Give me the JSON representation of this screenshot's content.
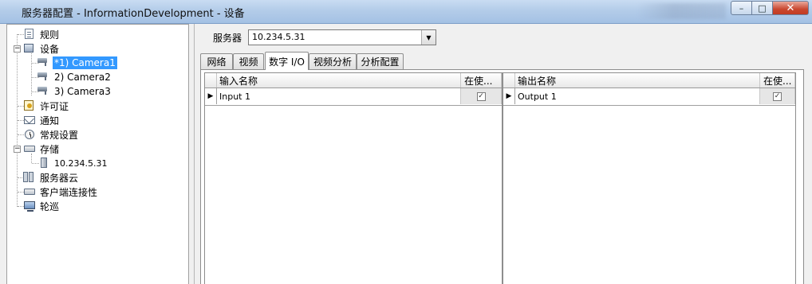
{
  "window": {
    "title": "服务器配置 - InformationDevelopment - 设备"
  },
  "tree": {
    "items": [
      {
        "label": "规则",
        "icon": "rules-doc-icon"
      },
      {
        "label": "设备",
        "icon": "device-icon",
        "expanded": true
      },
      {
        "label": "*1) Camera1",
        "icon": "camera-icon",
        "selected": true
      },
      {
        "label": "2) Camera2",
        "icon": "camera-icon"
      },
      {
        "label": "3) Camera3",
        "icon": "camera-icon"
      },
      {
        "label": "许可证",
        "icon": "license-icon"
      },
      {
        "label": "通知",
        "icon": "mail-icon"
      },
      {
        "label": "常规设置",
        "icon": "clock-icon"
      },
      {
        "label": "存储",
        "icon": "drive-icon",
        "expanded": true
      },
      {
        "label": "10.234.5.31",
        "icon": "server-icon"
      },
      {
        "label": "服务器云",
        "icon": "server-cloud-icon"
      },
      {
        "label": "客户端连接性",
        "icon": "drive-icon"
      },
      {
        "label": "轮巡",
        "icon": "monitor-icon"
      }
    ]
  },
  "server": {
    "label": "服务器",
    "selected": "10.234.5.31"
  },
  "tabs": [
    {
      "label": "网络"
    },
    {
      "label": "视频"
    },
    {
      "label": "数字 I/O",
      "active": true
    },
    {
      "label": "视频分析"
    },
    {
      "label": "分析配置"
    }
  ],
  "inputs": {
    "col_name": "输入名称",
    "col_inuse": "在使...",
    "rows": [
      {
        "name": "Input 1",
        "in_use": true
      }
    ]
  },
  "outputs": {
    "col_name": "输出名称",
    "col_inuse": "在使...",
    "rows": [
      {
        "name": "Output 1",
        "in_use": true
      }
    ]
  }
}
